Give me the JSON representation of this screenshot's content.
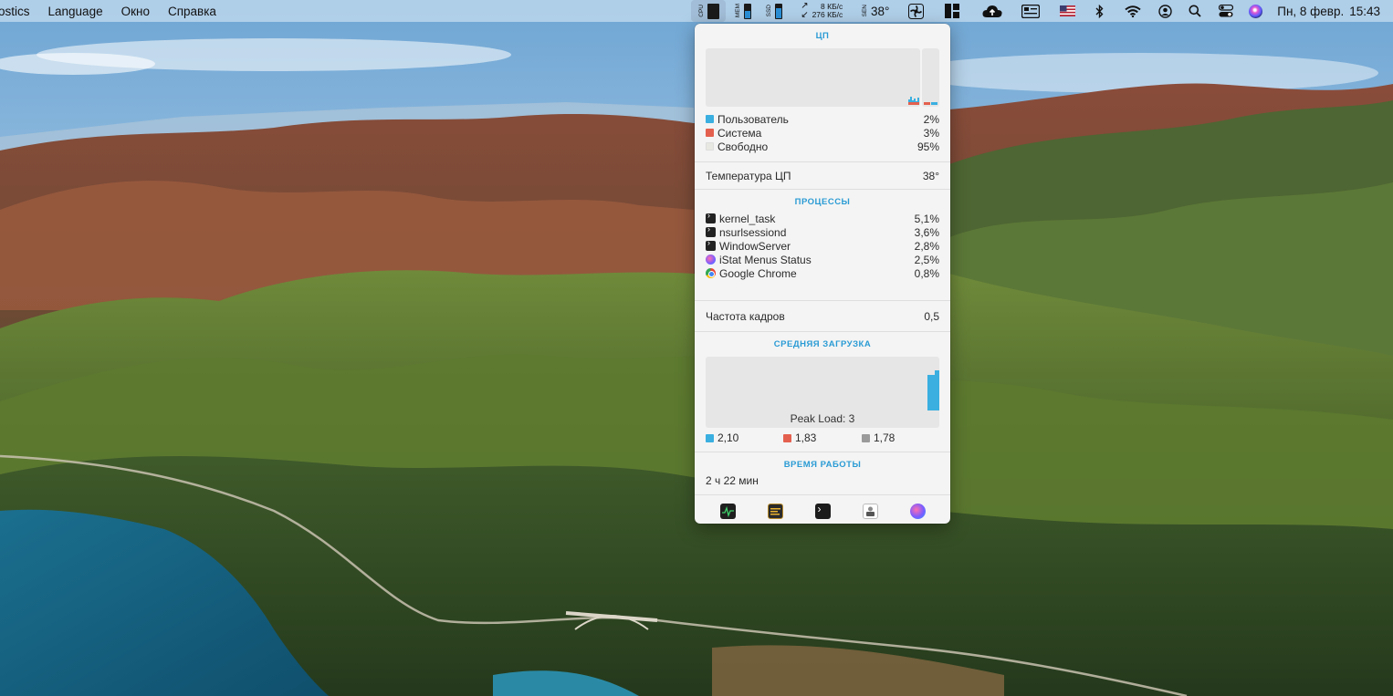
{
  "menubar": {
    "menus": [
      "ostics",
      "Language",
      "Окно",
      "Справка"
    ],
    "cpu_label": "CPU",
    "mem_label": "MEM",
    "disk_label": "SSD",
    "net_up": "8 КБ/с",
    "net_down": "276 КБ/с",
    "sensor_label": "SEN",
    "temperature": "38°",
    "date": "Пн, 8 февр.",
    "time": "15:43",
    "icons": [
      "fan-icon",
      "grid-icon",
      "cloud-icon",
      "menu-display-icon",
      "us-flag-icon",
      "bluetooth-icon",
      "wifi-icon",
      "user-icon",
      "search-icon",
      "control-center-icon",
      "siri-icon"
    ]
  },
  "panel": {
    "cpu_title": "ЦП",
    "cpu_stats": [
      {
        "label": "Пользователь",
        "value": "2%",
        "color": "#3aafe0"
      },
      {
        "label": "Система",
        "value": "3%",
        "color": "#e4604e"
      },
      {
        "label": "Свободно",
        "value": "95%",
        "color": "#e8e8e2"
      }
    ],
    "temp_label": "Температура ЦП",
    "temp_value": "38°",
    "processes_title": "ПРОЦЕССЫ",
    "processes": [
      {
        "name": "kernel_task",
        "value": "5,1%",
        "icon": "terminal-icon"
      },
      {
        "name": "nsurlsessiond",
        "value": "3,6%",
        "icon": "terminal-icon"
      },
      {
        "name": "WindowServer",
        "value": "2,8%",
        "icon": "terminal-icon"
      },
      {
        "name": "iStat Menus Status",
        "value": "2,5%",
        "icon": "istat-icon"
      },
      {
        "name": "Google Chrome",
        "value": "0,8%",
        "icon": "chrome-icon"
      }
    ],
    "fps_label": "Частота кадров",
    "fps_value": "0,5",
    "load_title": "СРЕДНЯЯ ЗАГРУЗКА",
    "peak_load": "Peak Load: 3",
    "load_averages": [
      {
        "value": "2,10",
        "color": "#3aafe0"
      },
      {
        "value": "1,83",
        "color": "#e4604e"
      },
      {
        "value": "1,78",
        "color": "#9a9a9a"
      }
    ],
    "uptime_title": "ВРЕМЯ РАБОТЫ",
    "uptime_value": "2 ч 22 мин",
    "footer_icons": [
      "activity-monitor-icon",
      "console-icon",
      "terminal-icon",
      "istat-helper-icon",
      "istat-menus-icon"
    ]
  }
}
